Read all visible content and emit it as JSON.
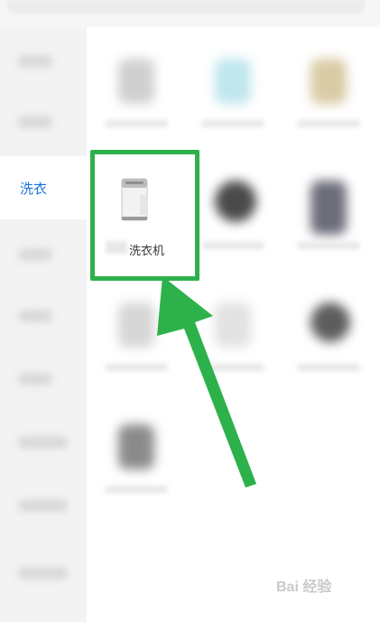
{
  "sidebar": {
    "active_label": "洗衣"
  },
  "highlight": {
    "label": "洗衣机",
    "border_color": "#2db14b"
  },
  "arrow_color": "#2db14b",
  "watermark": {
    "text": "Bai 经验"
  }
}
